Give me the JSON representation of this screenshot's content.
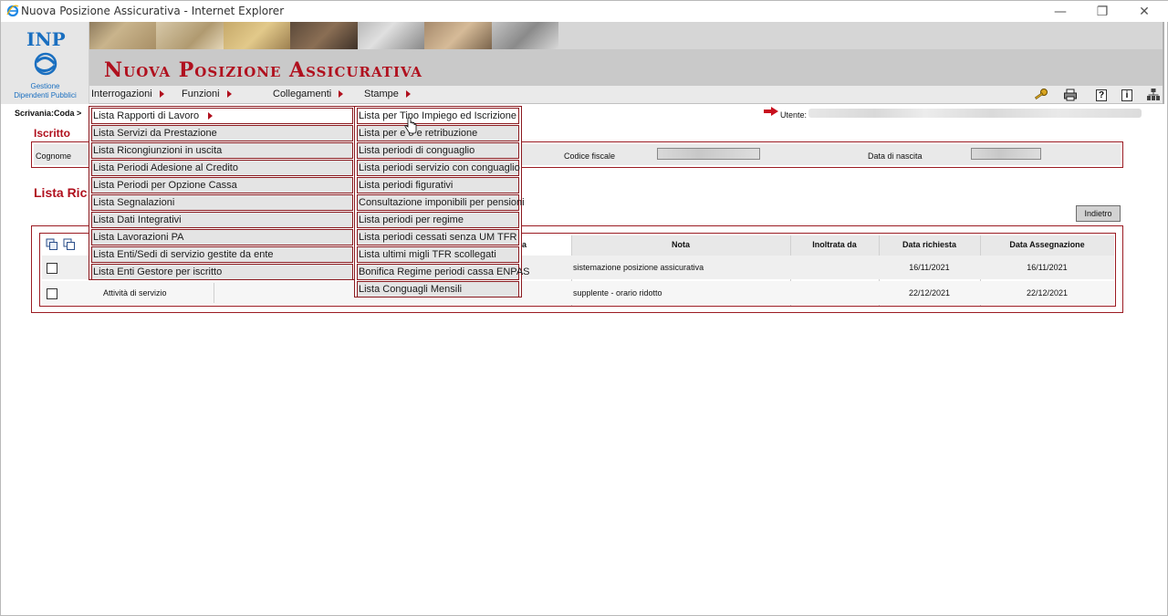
{
  "window": {
    "title": "Nuova Posizione Assicurativa - Internet Explorer",
    "minimize": "—",
    "maximize": "❐",
    "close": "✕"
  },
  "header": {
    "logo_text": "INPS",
    "logo_caption_1": "Gestione",
    "logo_caption_2": "Dipendenti Pubblici",
    "app_title": "Nuova Posizione Assicurativa",
    "brand_color": "#b0101e"
  },
  "menu": {
    "items": [
      {
        "label": "Interrogazioni"
      },
      {
        "label": "Funzioni"
      },
      {
        "label": "Collegamenti"
      },
      {
        "label": "Stampe"
      }
    ],
    "tools": [
      "key-icon",
      "printer-icon",
      "help-icon",
      "info-icon",
      "sitemap-icon"
    ],
    "help_glyph": "?",
    "info_glyph": "i"
  },
  "breadcrumb": "Scrivania:Coda >",
  "user_label": "Utente:",
  "iscritto": {
    "title": "Iscritto",
    "cognome_label": "Cognome",
    "codice_fiscale_label": "Codice fiscale",
    "data_nascita_label": "Data di nascita"
  },
  "lista": {
    "title": "Lista Ric",
    "back_button": "Indietro",
    "columns": {
      "tipo_fragment": "ca",
      "nota": "Nota",
      "inoltrata": "Inoltrata da",
      "data_richiesta": "Data richiesta",
      "data_assegnazione": "Data Assegnazione"
    },
    "rows": [
      {
        "tipo": "",
        "nota": "sistemazione posizione assicurativa",
        "inoltrata": "",
        "data_richiesta": "16/11/2021",
        "data_assegnazione": "16/11/2021"
      },
      {
        "tipo": "Attività di servizio",
        "nota": "supplente - orario ridotto",
        "inoltrata": "",
        "data_richiesta": "22/12/2021",
        "data_assegnazione": "22/12/2021"
      }
    ]
  },
  "dropdown_main": [
    {
      "label": "Lista Rapporti di Lavoro"
    },
    {
      "label": "Lista Servizi da Prestazione"
    },
    {
      "label": "Lista Ricongiunzioni in uscita"
    },
    {
      "label": "Lista Periodi Adesione al Credito"
    },
    {
      "label": "Lista Periodi per Opzione Cassa"
    },
    {
      "label": "Lista Segnalazioni"
    },
    {
      "label": "Lista Dati Integrativi"
    },
    {
      "label": "Lista Lavorazioni PA"
    },
    {
      "label": "Lista Enti/Sedi di servizio gestite da ente"
    },
    {
      "label": "Lista Enti Gestore per iscritto"
    }
  ],
  "dropdown_sub": [
    {
      "label": "Lista per Tipo Impiego ed Iscrizione"
    },
    {
      "label": "Lista per ente e retribuzione",
      "visible_label": "Lista per e    o e retribuzione"
    },
    {
      "label": "Lista periodi di conguaglio"
    },
    {
      "label": "Lista periodi servizio con conguaglio"
    },
    {
      "label": "Lista periodi figurativi"
    },
    {
      "label": "Consultazione imponibili per pensioni"
    },
    {
      "label": "Lista periodi per regime"
    },
    {
      "label": "Lista periodi cessati senza UM TFR"
    },
    {
      "label": "Lista ultimi migli TFR scollegati"
    },
    {
      "label": "Bonifica Regime periodi cassa ENPAS"
    },
    {
      "label": "Lista Conguagli Mensili"
    }
  ]
}
